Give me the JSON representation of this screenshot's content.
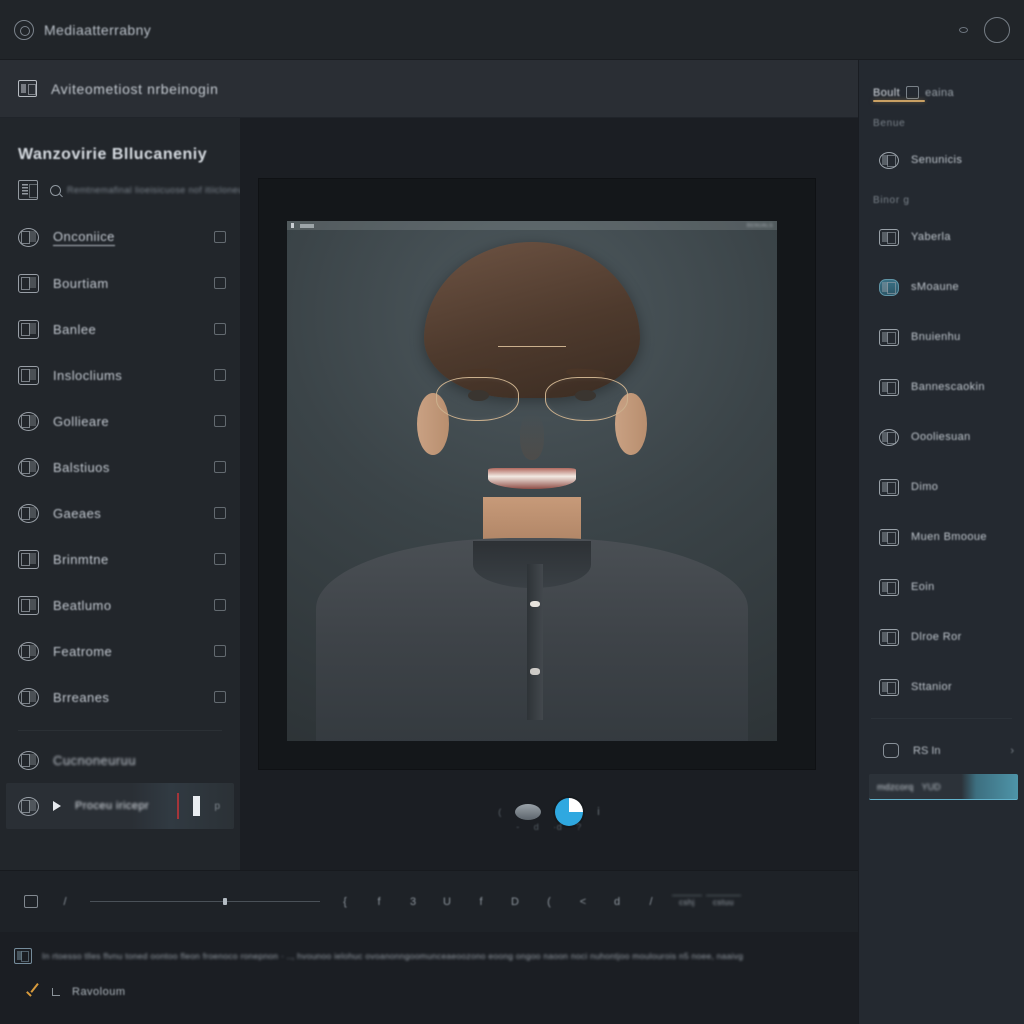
{
  "window": {
    "app_icon": "app-logo-icon",
    "title": "Mediaatterrabny",
    "right_icons": [
      "status-dot-icon",
      "user-avatar-icon"
    ]
  },
  "subheader": {
    "icon": "module-icon",
    "breadcrumb": "Aviteometiost nrbeinogin"
  },
  "sidebar": {
    "title": "Wanzovirie Bllucaneniy",
    "search": {
      "icon": "filter-panel-icon",
      "search_icon": "search-icon",
      "placeholder": "Remtnemafinal lioeisicuose nof itiicloneu eeeuronygs Nis"
    },
    "items": [
      {
        "label": "Onconiice",
        "icon": "document-icon",
        "right_icon": "edit-icon",
        "shape": "square",
        "state": "active"
      },
      {
        "label": "Bourtiam",
        "icon": "layers-icon",
        "right_icon": "copy-icon",
        "shape": "square",
        "state": "normal"
      },
      {
        "label": "Banlee",
        "icon": "image-icon",
        "right_icon": "eye-icon",
        "shape": "square",
        "state": "normal"
      },
      {
        "label": "Inslocliums",
        "icon": "grid-icon",
        "right_icon": "link-icon",
        "shape": "square",
        "state": "normal"
      },
      {
        "label": "Gollieare",
        "icon": "circle-icon",
        "right_icon": "cursor-icon",
        "shape": "round",
        "state": "normal"
      },
      {
        "label": "Balstiuos",
        "icon": "shield-icon",
        "right_icon": "dot-icon",
        "shape": "round",
        "state": "normal"
      },
      {
        "label": "Gaeaes",
        "icon": "paint-icon",
        "right_icon": "square-icon",
        "shape": "round",
        "state": "normal"
      },
      {
        "label": "Brinmtne",
        "icon": "table-icon",
        "right_icon": "flag-icon",
        "shape": "square",
        "state": "normal"
      },
      {
        "label": "Beatlumo",
        "icon": "photo-icon",
        "right_icon": "heart-icon",
        "shape": "square",
        "state": "normal"
      },
      {
        "label": "Featrome",
        "icon": "globe-icon",
        "right_icon": "pencil-icon",
        "shape": "round",
        "state": "normal"
      },
      {
        "label": "Brreanes",
        "icon": "cloud-icon",
        "right_icon": "shield-icon",
        "shape": "round",
        "state": "normal"
      },
      {
        "label": "Cucnoneuruu",
        "icon": "settings-icon",
        "right_icon": "chevron-icon",
        "shape": "round",
        "state": "normal"
      }
    ],
    "selected_item": {
      "icon": "lock-icon",
      "label": "Proceu  iricepr",
      "trailing": "p"
    }
  },
  "canvas": {
    "photo_overlay": {
      "corner_dot": "handle-dot",
      "chip": "crop-handle",
      "label": "BENUALS"
    },
    "dial": {
      "left_tick": "(",
      "ellipse": "shadow-ellipse",
      "wheel": "progress-dial",
      "right_tick": "i",
      "sub_ticks": [
        "-",
        "d",
        "·d",
        "?"
      ]
    }
  },
  "right_panel": {
    "tabs": [
      {
        "label": "Boult",
        "active": true
      },
      {
        "label": "",
        "icon": "clipboard-icon",
        "active": false
      },
      {
        "label": "eaina",
        "active": false
      }
    ],
    "accent_color": "#c9a063",
    "sections": [
      {
        "header": "Benue",
        "items": [
          {
            "label": "Senunicis",
            "icon": "brush-icon",
            "style": "plain"
          }
        ]
      },
      {
        "header": "Binor g",
        "items": [
          {
            "label": "Yaberla",
            "icon": "video-icon",
            "style": "plain"
          },
          {
            "label": "sMoaune",
            "icon": "capsule-icon",
            "style": "teal"
          },
          {
            "label": "Bnuienhu",
            "icon": "qr-icon",
            "style": "plain"
          },
          {
            "label": "Bannescaokin",
            "icon": "archive-icon",
            "style": "plain"
          }
        ]
      },
      {
        "header": "",
        "items": [
          {
            "label": "Oooliesuan",
            "icon": "cloud-icon",
            "style": "plain"
          },
          {
            "label": "Dimo",
            "icon": "sr-badge-icon",
            "style": "plain"
          },
          {
            "label": "Muen Bmooue",
            "icon": "card-icon",
            "style": "plain"
          },
          {
            "label": "Eoin",
            "icon": "ticket-icon",
            "style": "plain"
          },
          {
            "label": "Dlroe Ror",
            "icon": "window-icon",
            "style": "plain"
          },
          {
            "label": "Sttanior",
            "icon": "printer-icon",
            "style": "plain"
          }
        ]
      }
    ],
    "bottom_row": {
      "icon": "info-icon",
      "label": "RS In",
      "end_icon": "chevron-right-icon"
    },
    "field": {
      "name": "mdzcorq",
      "value": "YUD"
    }
  },
  "toolbar": {
    "items": [
      {
        "icon": "cursor-tool-icon",
        "label": ""
      },
      {
        "icon": "divider",
        "label": "/"
      },
      {
        "icon": "slider-track",
        "label": ""
      },
      {
        "icon": "brace-icon",
        "label": "{"
      },
      {
        "icon": "pen-icon",
        "label": "f"
      },
      {
        "icon": "shape-icon",
        "label": "3"
      },
      {
        "icon": "crop-icon",
        "label": "U"
      },
      {
        "icon": "text-icon",
        "label": "f"
      },
      {
        "icon": "stamp-icon",
        "label": "D"
      },
      {
        "icon": "gradient-icon",
        "label": "("
      },
      {
        "icon": "eraser-icon",
        "label": "<"
      },
      {
        "icon": "dodge-icon",
        "label": "d"
      },
      {
        "icon": "separator",
        "label": "/"
      }
    ],
    "chips": [
      "cshj",
      "cstuu"
    ]
  },
  "statusbar": {
    "icon": "info-panel-icon",
    "message": "In rtoesso tlles flvnu toned  oontoo  fleon froenoco ronepnon  ·  ..,  hvounoo ielohuc  ovoanonngoomunceaeoozono eoong  ongoo naoon noci nuhontjoo moulourois n5 noee, naaivg",
    "second_row": {
      "check_icon": "check-icon",
      "sub_icon": "crop-corner-icon",
      "label": "Ravoloum"
    }
  }
}
